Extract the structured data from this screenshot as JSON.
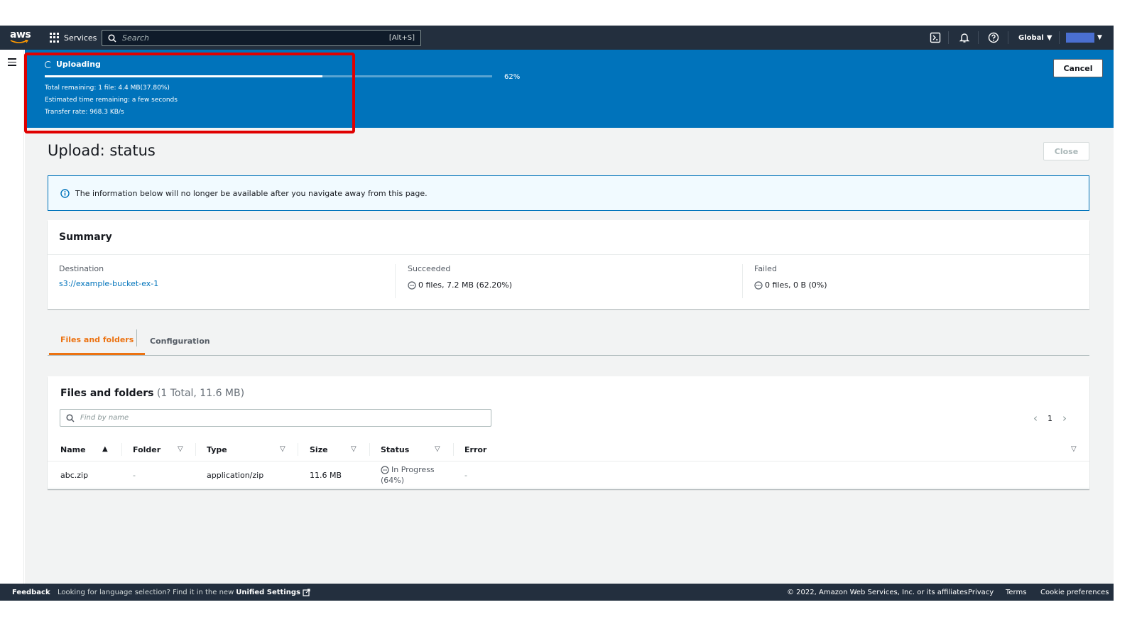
{
  "nav": {
    "logo_text": "aws",
    "services_label": "Services",
    "search_placeholder": "Search",
    "search_shortcut": "[Alt+S]",
    "region_label": "Global",
    "account_color": "#4a6fd1"
  },
  "flash": {
    "title": "Uploading",
    "progress_percent": 62,
    "progress_label": "62%",
    "total_remaining": "Total remaining: 1 file: 4.4 MB(37.80%)",
    "estimated_time": "Estimated time remaining: a few seconds",
    "transfer_rate": "Transfer rate: 968.3 KB/s",
    "cancel_label": "Cancel"
  },
  "page": {
    "title": "Upload: status",
    "close_label": "Close"
  },
  "alert": {
    "text": "The information below will no longer be available after you navigate away from this page."
  },
  "summary": {
    "title": "Summary",
    "destination_label": "Destination",
    "destination_value": "s3://example-bucket-ex-1",
    "succeeded_label": "Succeeded",
    "succeeded_value": "0 files, 7.2 MB (62.20%)",
    "failed_label": "Failed",
    "failed_value": "0 files, 0 B (0%)"
  },
  "tabs": [
    {
      "label": "Files and folders",
      "active": true
    },
    {
      "label": "Configuration",
      "active": false
    }
  ],
  "files": {
    "title": "Files and folders",
    "count": "(1 Total, 11.6 MB)",
    "filter_placeholder": "Find by name",
    "page_number": "1",
    "columns": [
      "Name",
      "Folder",
      "Type",
      "Size",
      "Status",
      "Error"
    ],
    "rows": [
      {
        "name": "abc.zip",
        "folder": "-",
        "type": "application/zip",
        "size": "11.6 MB",
        "status_line1": "In Progress",
        "status_line2": "(64%)",
        "error": "-"
      }
    ]
  },
  "footer": {
    "feedback": "Feedback",
    "language_text": "Looking for language selection? Find it in the new",
    "unified_settings": "Unified Settings",
    "copyright": "© 2022, Amazon Web Services, Inc. or its affiliates.",
    "privacy": "Privacy",
    "terms": "Terms",
    "cookie": "Cookie preferences"
  },
  "colors": {
    "nav_bg": "#232f3e",
    "flash_bg": "#0073bb",
    "accent_orange": "#ec7211",
    "link_blue": "#0073bb",
    "highlight_red": "#e00000"
  }
}
